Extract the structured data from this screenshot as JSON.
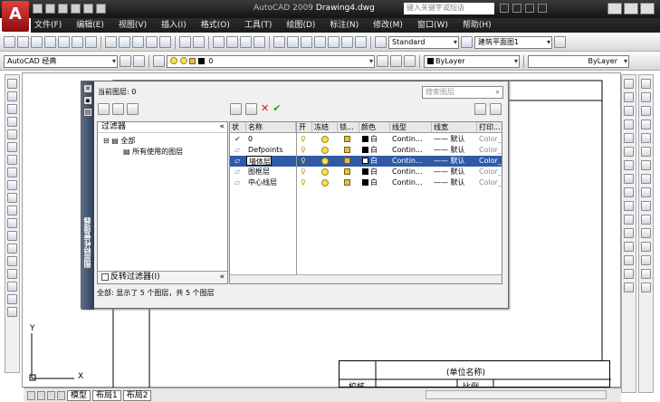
{
  "app": {
    "logo": "A",
    "title": "AutoCAD 2009",
    "doc": "Drawing4.dwg",
    "search_placeholder": "键入关键字或短语"
  },
  "menu": [
    "文件(F)",
    "编辑(E)",
    "视图(V)",
    "插入(I)",
    "格式(O)",
    "工具(T)",
    "绘图(D)",
    "标注(N)",
    "修改(M)",
    "窗口(W)",
    "帮助(H)"
  ],
  "toolbar1": {
    "text_style": "Standard",
    "dim_style": "建筑平面图1"
  },
  "toolbar2": {
    "workspace": "AutoCAD 经典",
    "layer": "0",
    "color": "ByLayer",
    "linetype": "ByLayer"
  },
  "layer_dialog": {
    "vertical_title": "图层特性管理器",
    "current_layer": "当前图层: 0",
    "search_placeholder": "搜索图层",
    "filter_header": "过滤器",
    "filter_all": "全部",
    "filter_used": "所有使用的图层",
    "invert_filter": "反转过滤器(I)",
    "collapse": "«",
    "columns": [
      "状",
      "名称",
      "开",
      "冻结",
      "锁...",
      "颜色",
      "线型",
      "线宽",
      "打印..."
    ],
    "rows": [
      {
        "name": "0",
        "color": "白",
        "linetype": "Contin...",
        "lineweight": "—— 默认",
        "plot": "Color_",
        "current": true,
        "selected": false
      },
      {
        "name": "Defpoints",
        "color": "白",
        "linetype": "Contin...",
        "lineweight": "—— 默认",
        "plot": "Color_",
        "current": false,
        "selected": false
      },
      {
        "name": "墙体层",
        "color": "白",
        "linetype": "Contin...",
        "lineweight": "—— 默认",
        "plot": "Color_",
        "current": false,
        "selected": true
      },
      {
        "name": "图框层",
        "color": "白",
        "linetype": "Contin...",
        "lineweight": "—— 默认",
        "plot": "Color_",
        "current": false,
        "selected": false
      },
      {
        "name": "中心线层",
        "color": "白",
        "linetype": "Contin...",
        "lineweight": "—— 默认",
        "plot": "Color_",
        "current": false,
        "selected": false
      }
    ],
    "status": "全部: 显示了 5 个图层，共 5 个图层"
  },
  "drawing": {
    "unit_name": "(单位名称)",
    "cell1": "校核",
    "cell2": "比例",
    "ucs_y": "Y",
    "ucs_x": "X"
  },
  "tabs": [
    "模型",
    "布局1",
    "布局2"
  ]
}
